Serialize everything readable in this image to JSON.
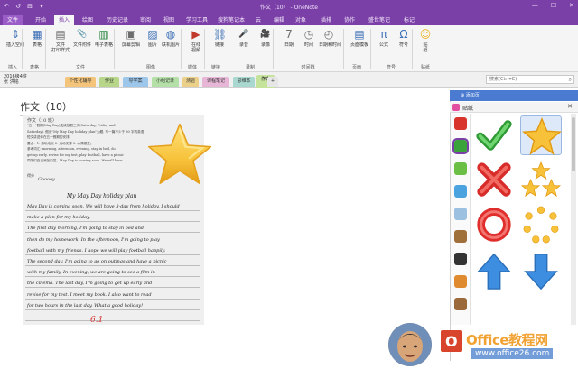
{
  "window": {
    "title": "作文（10） - OneNote",
    "min": "—",
    "max": "☐",
    "close": "✕"
  },
  "ribbon_tabs": [
    "文件",
    "开始",
    "插入",
    "绘图",
    "历史记录",
    "审阅",
    "视图",
    "学习工具",
    "搜狗笔记本",
    "云",
    "编辑",
    "对象",
    "插排",
    "协作",
    "盛世笔记",
    "标记"
  ],
  "active_tab_index": 2,
  "ribbon_buttons": [
    {
      "label": "插入空间",
      "icon": "insert-space-icon"
    },
    {
      "label": "表格",
      "icon": "table-icon"
    },
    {
      "label": "文件\n打印样式",
      "icon": "file-printout-icon"
    },
    {
      "label": "文件附件",
      "icon": "attachment-icon"
    },
    {
      "label": "电子表格",
      "icon": "spreadsheet-icon"
    },
    {
      "label": "屏幕剪辑",
      "icon": "screen-clip-icon"
    },
    {
      "label": "图片",
      "icon": "picture-icon"
    },
    {
      "label": "联机图片",
      "icon": "online-picture-icon"
    },
    {
      "label": "在线\n视频",
      "icon": "online-video-icon"
    },
    {
      "label": "链接",
      "icon": "link-icon"
    },
    {
      "label": "录音",
      "icon": "microphone-icon"
    },
    {
      "label": "录像",
      "icon": "camera-icon"
    },
    {
      "label": "日期",
      "icon": "calendar-icon"
    },
    {
      "label": "时间",
      "icon": "clock-icon"
    },
    {
      "label": "日期和时间",
      "icon": "datetime-icon"
    },
    {
      "label": "页面模板",
      "icon": "page-template-icon"
    },
    {
      "label": "公式",
      "icon": "pi-icon"
    },
    {
      "label": "符号",
      "icon": "omega-icon"
    },
    {
      "label": "贴\n纸",
      "icon": "sticker-icon"
    }
  ],
  "ribbon_groups": [
    "插入",
    "表格",
    "文件",
    "图像",
    "媒体",
    "链接",
    "录制",
    "时间戳",
    "页面",
    "符号",
    "贴纸"
  ],
  "notebook": {
    "name": "2016级4班\n张 洪铭",
    "sections": [
      {
        "label": "个性化辅导",
        "color": "#f3c47a"
      },
      {
        "label": "作业",
        "color": "#b7d68a"
      },
      {
        "label": "导学案",
        "color": "#9cc6ea"
      },
      {
        "label": "小组记录",
        "color": "#b4e0a8"
      },
      {
        "label": "测验",
        "color": "#ebd08a"
      },
      {
        "label": "课程笔记",
        "color": "#e7b6d6"
      },
      {
        "label": "思维本",
        "color": "#a9d8d0"
      },
      {
        "label": "作文",
        "color": "#c6e39c"
      }
    ],
    "active_section_index": 7,
    "add_section": "+",
    "search_placeholder": "搜索(Ctrl+E)"
  },
  "page": {
    "title": "作文（10）"
  },
  "paper": {
    "header": "作文（10 班）",
    "lines_printed": [
      "\"五一\"假期(May Day)连续放假三天(Saturday, Friday and",
      "Saturday). 假设\"My May Day holiday plan\"为题, 写一篇不少于 80 字的英语",
      "短文讲述你在五一假期的安排。",
      "要点：1. 游玩地点 2. 活动安排 3. 心情感受。",
      "参考词汇: morning, afternoon, evening, stay in bed, do",
      "get up early, revise for my test, play football, have a picnic",
      "同学们自己添加内容。May Day is coming soon. We will have"
    ],
    "score_label": "得分",
    "grade": "Gooooy",
    "hand_title": "My May Day holiday plan",
    "hand_lines": [
      "May Day is coming soon. We will have 3-day from holiday. I should",
      "make a plan for my holiday.",
      "The first day morning, I'm going to stay in bed and",
      "then do my homework. In the afternoon, I'm going to play",
      "football with my friends. I hope we will play football happily.",
      "The second day, I'm going to go on outings and have a picnic",
      "with my family. In evening, we are going to see a film in",
      "the cinema. The last day, I'm going to get up early and",
      "revise for my test. I meet my book. I also want to read",
      "for two hours in the last day. What a good holiday!"
    ],
    "red_mark": "6.1"
  },
  "sticker_pane": {
    "header": "添加页",
    "title": "贴纸",
    "close": "✕",
    "categories": [
      {
        "name": "apple",
        "color": "#d9342b"
      },
      {
        "name": "checkmark",
        "color": "#3aa33a"
      },
      {
        "name": "monster",
        "color": "#6bbf45"
      },
      {
        "name": "monitor",
        "color": "#4aa3df"
      },
      {
        "name": "bottle",
        "color": "#9cc0e0"
      },
      {
        "name": "monkey",
        "color": "#a0703a"
      },
      {
        "name": "spider",
        "color": "#333333"
      },
      {
        "name": "tiger",
        "color": "#e08a2f"
      },
      {
        "name": "face",
        "color": "#9a6a3a"
      }
    ],
    "stickers": [
      {
        "name": "green-check-sticker",
        "selected": false
      },
      {
        "name": "gold-star-sticker",
        "selected": true
      },
      {
        "name": "red-x-sticker",
        "selected": false
      },
      {
        "name": "three-stars-sticker",
        "selected": false
      },
      {
        "name": "red-ring-sticker",
        "selected": false
      },
      {
        "name": "star-ring-sticker",
        "selected": false
      },
      {
        "name": "blue-up-arrow-sticker",
        "selected": false
      },
      {
        "name": "blue-down-arrow-sticker",
        "selected": false
      }
    ]
  },
  "watermark": {
    "logo_letter": "O",
    "brand": "Office教程网",
    "url": "www.office26.com"
  },
  "colors": {
    "accent_purple": "#7b3fa8",
    "pane_header_blue": "#4a7bd0",
    "star_gold": "#f7c23a",
    "check_green": "#39a83f",
    "x_red": "#e0302e"
  }
}
